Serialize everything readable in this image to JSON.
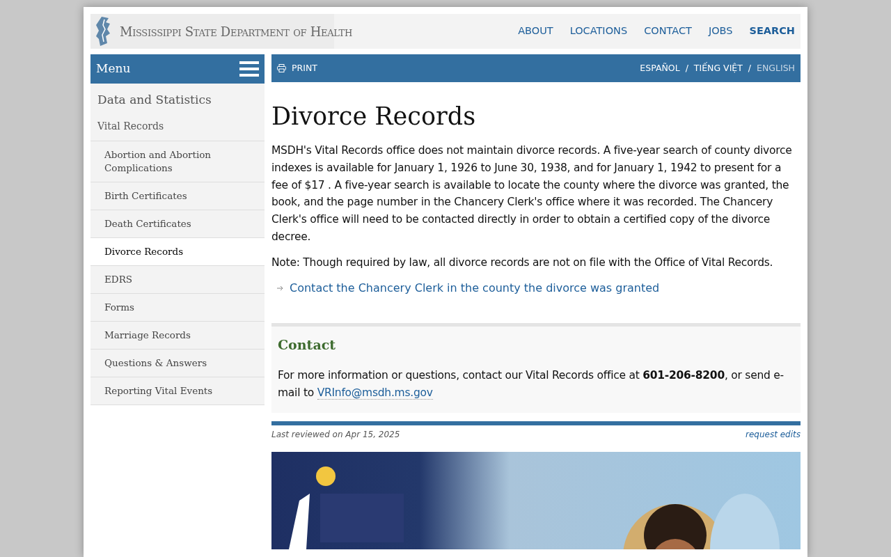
{
  "header": {
    "site_name": "Mississippi State Department of Health",
    "nav": [
      {
        "label": "ABOUT",
        "selected": false
      },
      {
        "label": "LOCATIONS",
        "selected": false
      },
      {
        "label": "CONTACT",
        "selected": false
      },
      {
        "label": "JOBS",
        "selected": false
      },
      {
        "label": "SEARCH",
        "selected": true
      }
    ]
  },
  "sidebar": {
    "menu_label": "Menu",
    "section": "Data and Statistics",
    "parent": "Vital Records",
    "items": [
      {
        "label": "Abortion and Abortion Complications",
        "selected": false
      },
      {
        "label": "Birth Certificates",
        "selected": false
      },
      {
        "label": "Death Certificates",
        "selected": false
      },
      {
        "label": "Divorce Records",
        "selected": true
      },
      {
        "label": "EDRS",
        "selected": false
      },
      {
        "label": "Forms",
        "selected": false
      },
      {
        "label": "Marriage Records",
        "selected": false
      },
      {
        "label": "Questions & Answers",
        "selected": false
      },
      {
        "label": "Reporting Vital Events",
        "selected": false
      }
    ]
  },
  "toolbar": {
    "print": "PRINT",
    "languages": [
      {
        "label": "ESPAÑOL",
        "selected": false
      },
      {
        "label": "TIẾNG VIỆT",
        "selected": false
      },
      {
        "label": "ENGLISH",
        "selected": true
      }
    ],
    "separator": "/"
  },
  "article": {
    "title": "Divorce Records",
    "paragraphs": [
      "MSDH's Vital Records office does not maintain divorce records. A five-year search of county divorce indexes is available for January 1, 1926 to June 30, 1938, and for January 1, 1942 to present for a fee of $17 . A five-year search is available to locate the county where the divorce was granted, the book, and the page number in the Chancery Clerk's office where it was recorded. The Chancery Clerk's office will need to be contacted directly in order to obtain a certified copy of the divorce decree.",
      "Note: Though required by law, all divorce records are not on file with the Office of Vital Records."
    ],
    "link": "Contact the Chancery Clerk in the county the divorce was granted"
  },
  "contact": {
    "title": "Contact",
    "text": "For more information or questions, contact our Vital Records office at **601-206-8200**, or send e-mail to ",
    "email": "VRInfo@msdh.ms.gov"
  },
  "footer": {
    "reviewed": "Last reviewed on Apr 15, 2025",
    "request_edits": "request edits"
  }
}
